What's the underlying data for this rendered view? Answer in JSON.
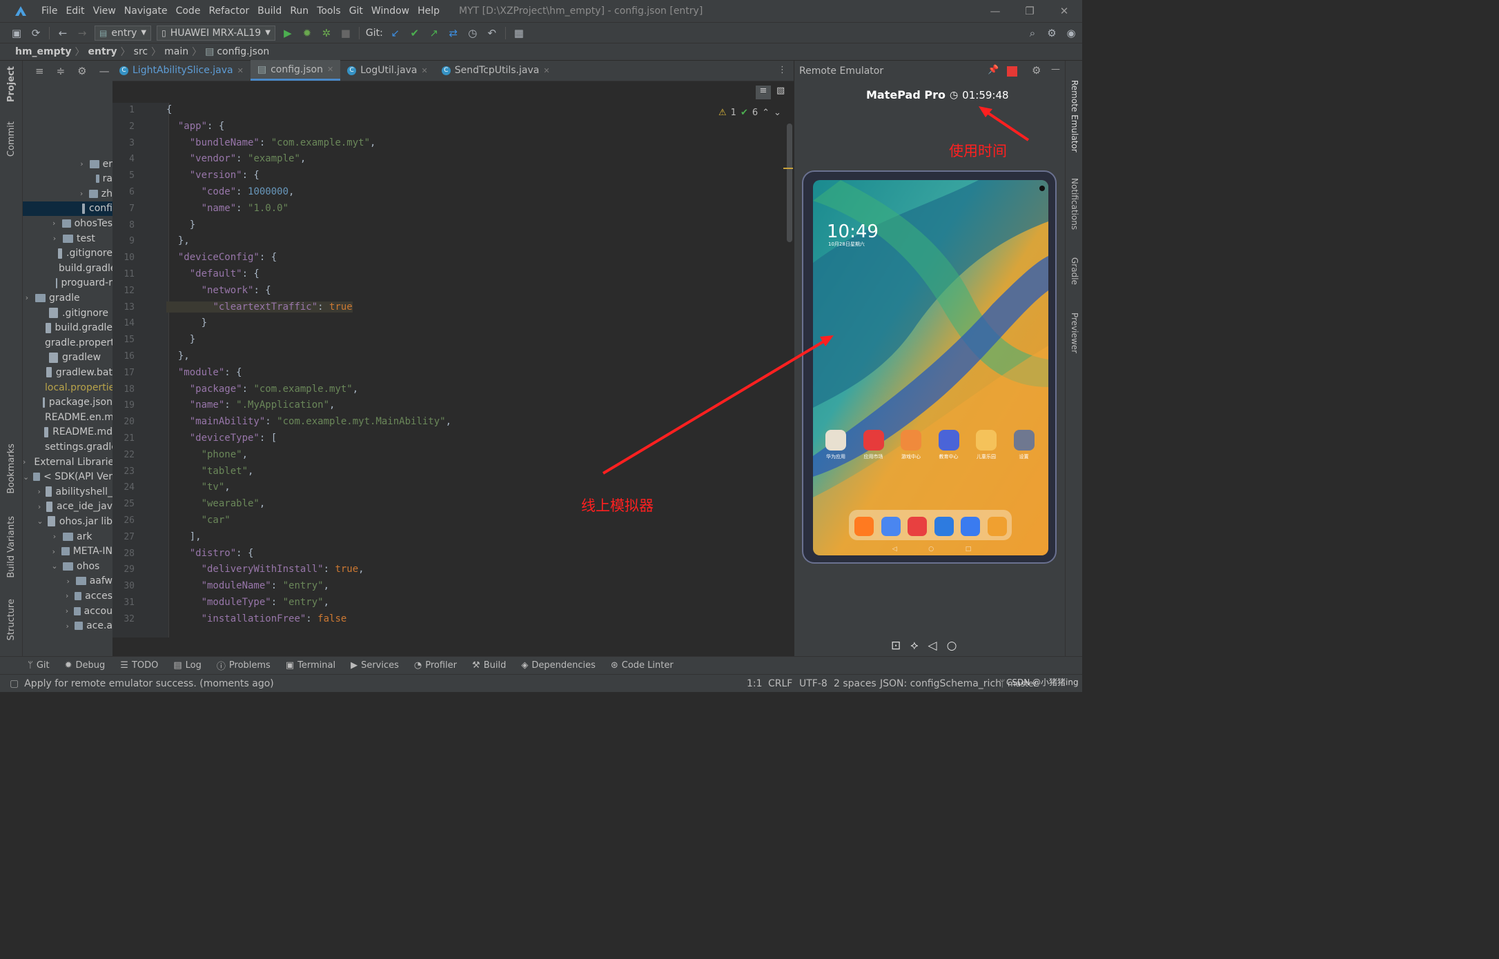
{
  "window": {
    "title": "MYT [D:\\XZProject\\hm_empty] - config.json [entry]",
    "menu": [
      "File",
      "Edit",
      "View",
      "Navigate",
      "Code",
      "Refactor",
      "Build",
      "Run",
      "Tools",
      "Git",
      "Window",
      "Help"
    ]
  },
  "toolbar": {
    "run_config": "entry",
    "device": "HUAWEI MRX-AL19",
    "git_label": "Git:"
  },
  "breadcrumb": [
    "hm_empty",
    "entry",
    "src",
    "main",
    "config.json"
  ],
  "left_tabs": {
    "project": "Project",
    "commit": "Commit",
    "bookmarks": "Bookmarks",
    "build_variants": "Build Variants",
    "structure": "Structure"
  },
  "project_tree": [
    {
      "label": "er",
      "arrow": "›",
      "folder": true
    },
    {
      "label": "ra",
      "arrow": "",
      "folder": true
    },
    {
      "label": "zh",
      "arrow": "›",
      "folder": true
    },
    {
      "label": "confi",
      "arrow": "",
      "folder": false,
      "selected": true
    },
    {
      "label": "ohosTes",
      "arrow": "›",
      "folder": true
    },
    {
      "label": "test",
      "arrow": "›",
      "folder": true
    },
    {
      "label": ".gitignore",
      "arrow": "",
      "folder": false
    },
    {
      "label": "build.gradle",
      "arrow": "",
      "folder": false
    },
    {
      "label": "proguard-r",
      "arrow": "",
      "folder": false
    },
    {
      "label": "gradle",
      "arrow": "›",
      "folder": true
    },
    {
      "label": ".gitignore",
      "arrow": "",
      "folder": false
    },
    {
      "label": "build.gradle",
      "arrow": "",
      "folder": false
    },
    {
      "label": "gradle.propert",
      "arrow": "",
      "folder": false
    },
    {
      "label": "gradlew",
      "arrow": "",
      "folder": false
    },
    {
      "label": "gradlew.bat",
      "arrow": "",
      "folder": false
    },
    {
      "label": "local.propertie",
      "arrow": "",
      "folder": false,
      "muted": true
    },
    {
      "label": "package.json",
      "arrow": "",
      "folder": false
    },
    {
      "label": "README.en.m",
      "arrow": "",
      "folder": false
    },
    {
      "label": "README.md",
      "arrow": "",
      "folder": false
    },
    {
      "label": "settings.gradle",
      "arrow": "",
      "folder": false
    },
    {
      "label": "External Libraries",
      "arrow": "›",
      "folder": false
    },
    {
      "label": "< SDK(API Ver",
      "arrow": "⌄",
      "folder": true
    },
    {
      "label": "abilityshell_",
      "arrow": "›",
      "folder": false
    },
    {
      "label": "ace_ide_jav",
      "arrow": "›",
      "folder": false
    },
    {
      "label": "ohos.jar  lib",
      "arrow": "⌄",
      "folder": false
    },
    {
      "label": "ark",
      "arrow": "›",
      "folder": true
    },
    {
      "label": "META-IN",
      "arrow": "›",
      "folder": true
    },
    {
      "label": "ohos",
      "arrow": "⌄",
      "folder": true
    },
    {
      "label": "aafw",
      "arrow": "›",
      "folder": true
    },
    {
      "label": "acces",
      "arrow": "›",
      "folder": true
    },
    {
      "label": "accou",
      "arrow": "›",
      "folder": true
    },
    {
      "label": "ace.a",
      "arrow": "›",
      "folder": true
    }
  ],
  "editor_tabs": [
    {
      "label": "LightAbilitySlice.java",
      "active": false,
      "java": true
    },
    {
      "label": "config.json",
      "active": true,
      "java": false
    },
    {
      "label": "LogUtil.java",
      "active": false,
      "java": true
    },
    {
      "label": "SendTcpUtils.java",
      "active": false,
      "java": true
    }
  ],
  "inspections": {
    "warnings": "1",
    "ok": "6"
  },
  "code_lines": [
    "{",
    "  \"app\": {",
    "    \"bundleName\": \"com.example.myt\",",
    "    \"vendor\": \"example\",",
    "    \"version\": {",
    "      \"code\": 1000000,",
    "      \"name\": \"1.0.0\"",
    "    }",
    "  },",
    "  \"deviceConfig\": {",
    "    \"default\": {",
    "      \"network\": {",
    "        \"cleartextTraffic\": true",
    "      }",
    "    }",
    "  },",
    "  \"module\": {",
    "    \"package\": \"com.example.myt\",",
    "    \"name\": \".MyApplication\",",
    "    \"mainAbility\": \"com.example.myt.MainAbility\",",
    "    \"deviceType\": [",
    "      \"phone\",",
    "      \"tablet\",",
    "      \"tv\",",
    "      \"wearable\",",
    "      \"car\"",
    "    ],",
    "    \"distro\": {",
    "      \"deliveryWithInstall\": true,",
    "      \"moduleName\": \"entry\",",
    "      \"moduleType\": \"entry\",",
    "      \"installationFree\": false"
  ],
  "emulator": {
    "panel_title": "Remote Emulator",
    "device_name": "MatePad Pro",
    "timer": "01:59:48",
    "clock": "10:49",
    "date": "10月28日星期六",
    "apps": [
      "华为应用",
      "应用市场",
      "游戏中心",
      "教育中心",
      "儿童乐园",
      "设置"
    ],
    "app_colors": [
      "#e8e0d0",
      "#e63b3b",
      "#f08a3c",
      "#4a64d8",
      "#f5c25a",
      "#6f7890"
    ],
    "dock_colors": [
      "#ff7a20",
      "#4a86f0",
      "#e84040",
      "#2d7be0",
      "#3a7bf0",
      "#f0a030"
    ]
  },
  "annotations": {
    "usage_time": "使用时间",
    "online_emulator": "线上模拟器"
  },
  "right_tabs": {
    "remote_emulator": "Remote Emulator",
    "notifications": "Notifications",
    "gradle": "Gradle",
    "previewer": "Previewer"
  },
  "bottom_tools": [
    "Git",
    "Debug",
    "TODO",
    "Log",
    "Problems",
    "Terminal",
    "Services",
    "Profiler",
    "Build",
    "Dependencies",
    "Code Linter"
  ],
  "status": {
    "message": "Apply for remote emulator success. (moments ago)",
    "position": "1:1",
    "line_sep": "CRLF",
    "encoding": "UTF-8",
    "indent": "2 spaces",
    "schema": "JSON: configSchema_rich",
    "branch": "master",
    "watermark": "CSDN @小猪猪ing"
  }
}
